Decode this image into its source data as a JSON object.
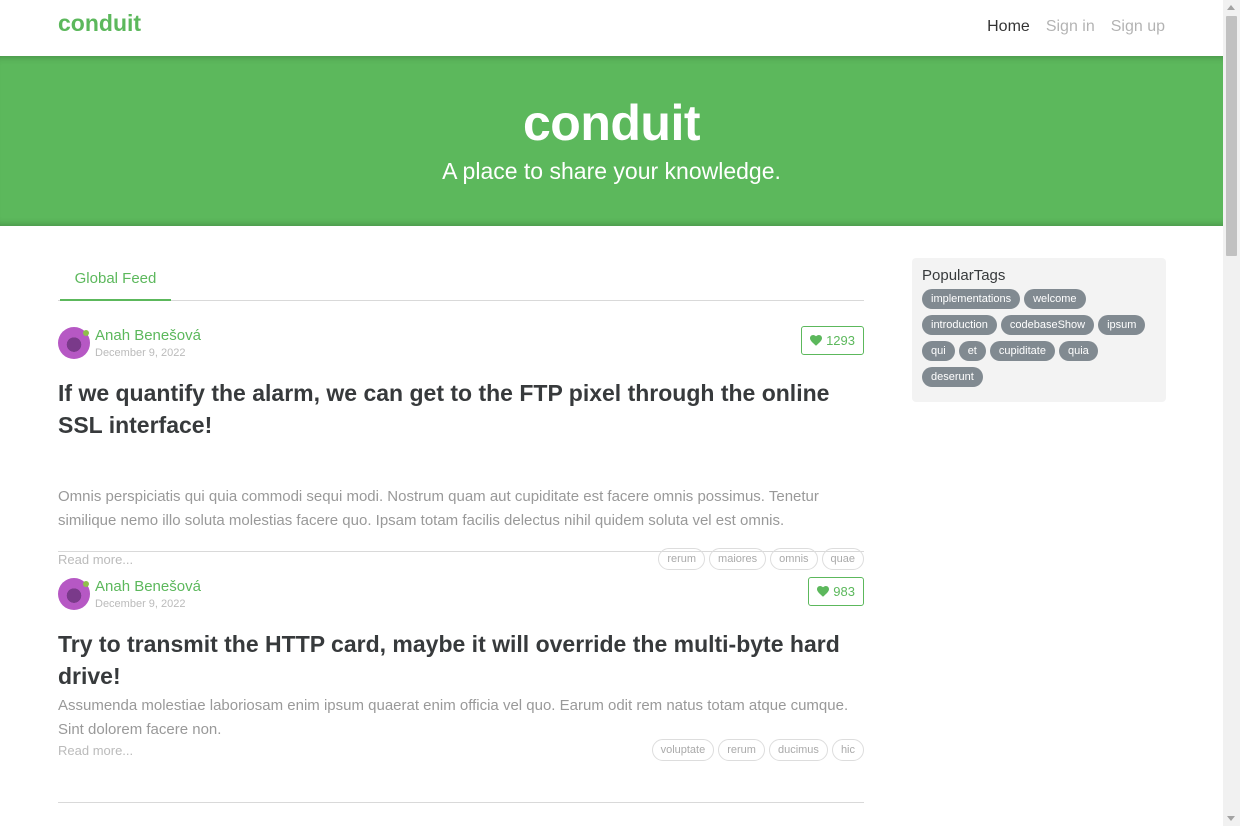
{
  "navbar": {
    "brand": "conduit",
    "links": [
      {
        "label": "Home",
        "active": true
      },
      {
        "label": "Sign in",
        "active": false
      },
      {
        "label": "Sign up",
        "active": false
      }
    ]
  },
  "banner": {
    "title": "conduit",
    "subtitle": "A place to share your knowledge."
  },
  "feed": {
    "tab": "Global Feed",
    "articles": [
      {
        "author": "Anah Benešová",
        "date": "December 9, 2022",
        "likes": "1293",
        "title": "If we quantify the alarm, we can get to the FTP pixel through the online SSL interface!",
        "description": "Omnis perspiciatis qui quia commodi sequi modi. Nostrum quam aut cupiditate est facere omnis possimus. Tenetur similique nemo illo soluta molestias facere quo. Ipsam totam facilis delectus nihil quidem soluta vel est omnis.",
        "read_more": "Read more...",
        "tags": [
          "rerum",
          "maiores",
          "omnis",
          "quae"
        ]
      },
      {
        "author": "Anah Benešová",
        "date": "December 9, 2022",
        "likes": "983",
        "title": "Try to transmit the HTTP card, maybe it will override the multi-byte hard drive!",
        "description": "Assumenda molestiae laboriosam enim ipsum quaerat enim officia vel quo. Earum odit rem natus totam atque cumque. Sint dolorem facere non.",
        "read_more": "Read more...",
        "tags": [
          "voluptate",
          "rerum",
          "ducimus",
          "hic"
        ]
      }
    ]
  },
  "sidebar": {
    "title": "PopularTags",
    "tags": [
      "implementations",
      "welcome",
      "introduction",
      "codebaseShow",
      "ipsum",
      "qui",
      "et",
      "cupiditate",
      "quia",
      "deserunt"
    ]
  },
  "colors": {
    "brand": "#5cb85c",
    "tag_pill": "#818a91"
  },
  "icons": {
    "like": "heart-icon",
    "avatar": "avatar-image"
  }
}
